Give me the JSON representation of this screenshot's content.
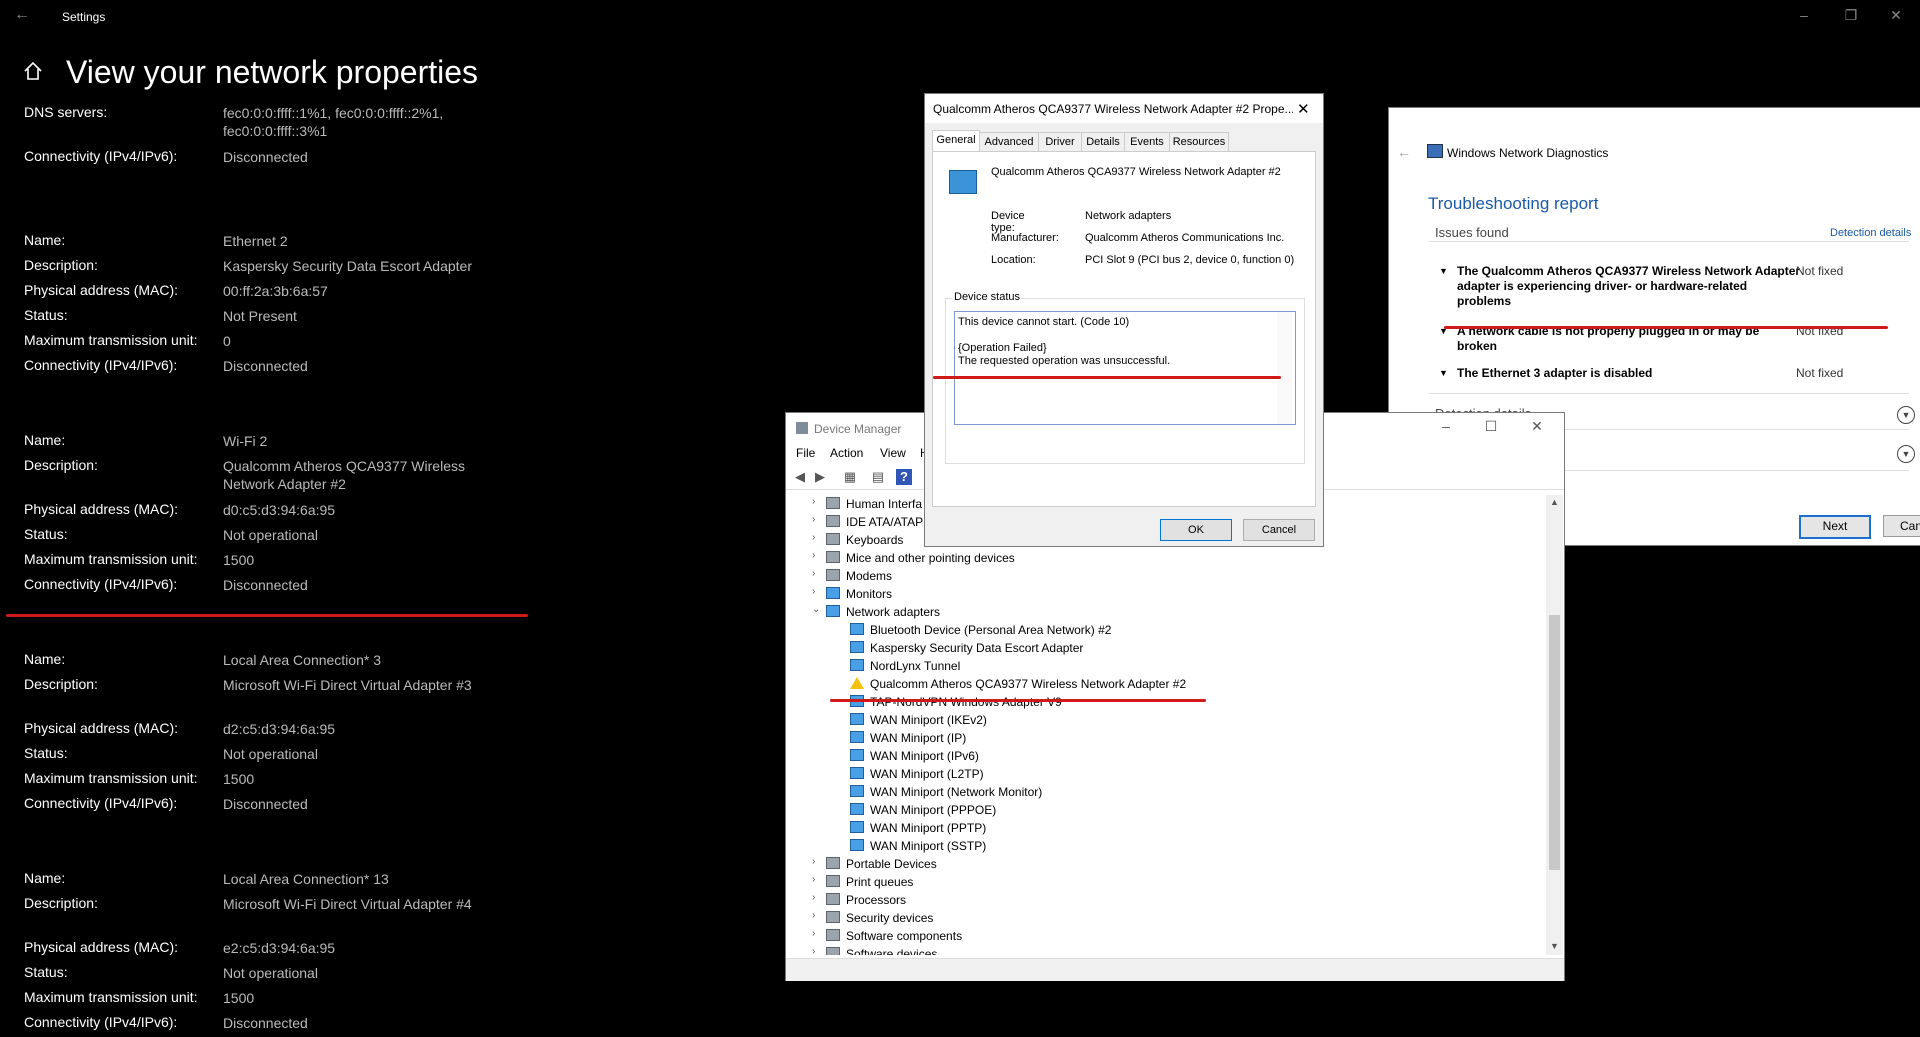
{
  "settings": {
    "window_title": "Settings",
    "page_title": "View your network properties",
    "rows": [
      {
        "label": "DNS servers:",
        "value": "fec0:0:0:ffff::1%1, fec0:0:0:ffff::2%1, fec0:0:0:ffff::3%1"
      },
      {
        "label": "Connectivity (IPv4/IPv6):",
        "value": "Disconnected"
      },
      {
        "label": "Name:",
        "value": "Ethernet 2"
      },
      {
        "label": "Description:",
        "value": "Kaspersky Security Data Escort Adapter"
      },
      {
        "label": "Physical address (MAC):",
        "value": "00:ff:2a:3b:6a:57"
      },
      {
        "label": "Status:",
        "value": "Not Present"
      },
      {
        "label": "Maximum transmission unit:",
        "value": "0"
      },
      {
        "label": "Connectivity (IPv4/IPv6):",
        "value": "Disconnected"
      },
      {
        "label": "Name:",
        "value": "Wi-Fi 2"
      },
      {
        "label": "Description:",
        "value": "Qualcomm Atheros QCA9377 Wireless Network Adapter #2"
      },
      {
        "label": "Physical address (MAC):",
        "value": "d0:c5:d3:94:6a:95"
      },
      {
        "label": "Status:",
        "value": "Not operational"
      },
      {
        "label": "Maximum transmission unit:",
        "value": "1500"
      },
      {
        "label": "Connectivity (IPv4/IPv6):",
        "value": "Disconnected"
      },
      {
        "label": "Name:",
        "value": "Local Area Connection* 3"
      },
      {
        "label": "Description:",
        "value": "Microsoft Wi-Fi Direct Virtual Adapter #3"
      },
      {
        "label": "Physical address (MAC):",
        "value": "d2:c5:d3:94:6a:95"
      },
      {
        "label": "Status:",
        "value": "Not operational"
      },
      {
        "label": "Maximum transmission unit:",
        "value": "1500"
      },
      {
        "label": "Connectivity (IPv4/IPv6):",
        "value": "Disconnected"
      },
      {
        "label": "Name:",
        "value": "Local Area Connection* 13"
      },
      {
        "label": "Description:",
        "value": "Microsoft Wi-Fi Direct Virtual Adapter #4"
      },
      {
        "label": "Physical address (MAC):",
        "value": "e2:c5:d3:94:6a:95"
      },
      {
        "label": "Status:",
        "value": "Not operational"
      },
      {
        "label": "Maximum transmission unit:",
        "value": "1500"
      },
      {
        "label": "Connectivity (IPv4/IPv6):",
        "value": "Disconnected"
      }
    ]
  },
  "diagnostics": {
    "app_title": "Windows Network Diagnostics",
    "heading": "Troubleshooting report",
    "issues_found": "Issues found",
    "detection_details_link": "Detection details",
    "issues": [
      {
        "text": "The Qualcomm Atheros QCA9377 Wireless Network Adapter adapter is experiencing driver- or hardware-related problems",
        "status": "Not fixed"
      },
      {
        "text": "A network cable is not properly plugged in or may be broken",
        "status": "Not fixed"
      },
      {
        "text": "The Ethernet 3 adapter is disabled",
        "status": "Not fixed"
      }
    ],
    "detection_details": "Detection details",
    "next_label": "Next",
    "cancel_label": "Canc"
  },
  "device_manager": {
    "title": "Device Manager",
    "menu": [
      "File",
      "Action",
      "View",
      "H"
    ],
    "tree": [
      {
        "label": "Human Interfa",
        "level": 0,
        "expanded": false,
        "icon": "generic"
      },
      {
        "label": "IDE ATA/ATAPI",
        "level": 0,
        "expanded": false,
        "icon": "generic"
      },
      {
        "label": "Keyboards",
        "level": 0,
        "expanded": false,
        "icon": "generic"
      },
      {
        "label": "Mice and other pointing devices",
        "level": 0,
        "expanded": false,
        "icon": "generic"
      },
      {
        "label": "Modems",
        "level": 0,
        "expanded": false,
        "icon": "generic"
      },
      {
        "label": "Monitors",
        "level": 0,
        "expanded": false,
        "icon": "network"
      },
      {
        "label": "Network adapters",
        "level": 0,
        "expanded": true,
        "icon": "network"
      },
      {
        "label": "Bluetooth Device (Personal Area Network) #2",
        "level": 1,
        "icon": "network"
      },
      {
        "label": "Kaspersky Security Data Escort Adapter",
        "level": 1,
        "icon": "network"
      },
      {
        "label": "NordLynx Tunnel",
        "level": 1,
        "icon": "network"
      },
      {
        "label": "Qualcomm Atheros QCA9377 Wireless Network Adapter #2",
        "level": 1,
        "icon": "warning"
      },
      {
        "label": "TAP-NordVPN Windows Adapter V9",
        "level": 1,
        "icon": "network"
      },
      {
        "label": "WAN Miniport (IKEv2)",
        "level": 1,
        "icon": "network"
      },
      {
        "label": "WAN Miniport (IP)",
        "level": 1,
        "icon": "network"
      },
      {
        "label": "WAN Miniport (IPv6)",
        "level": 1,
        "icon": "network"
      },
      {
        "label": "WAN Miniport (L2TP)",
        "level": 1,
        "icon": "network"
      },
      {
        "label": "WAN Miniport (Network Monitor)",
        "level": 1,
        "icon": "network"
      },
      {
        "label": "WAN Miniport (PPPOE)",
        "level": 1,
        "icon": "network"
      },
      {
        "label": "WAN Miniport (PPTP)",
        "level": 1,
        "icon": "network"
      },
      {
        "label": "WAN Miniport (SSTP)",
        "level": 1,
        "icon": "network"
      },
      {
        "label": "Portable Devices",
        "level": 0,
        "expanded": false,
        "icon": "generic"
      },
      {
        "label": "Print queues",
        "level": 0,
        "expanded": false,
        "icon": "generic"
      },
      {
        "label": "Processors",
        "level": 0,
        "expanded": false,
        "icon": "generic"
      },
      {
        "label": "Security devices",
        "level": 0,
        "expanded": false,
        "icon": "generic"
      },
      {
        "label": "Software components",
        "level": 0,
        "expanded": false,
        "icon": "generic"
      },
      {
        "label": "Software devices",
        "level": 0,
        "expanded": false,
        "icon": "generic"
      }
    ]
  },
  "properties": {
    "title": "Qualcomm Atheros QCA9377 Wireless Network Adapter #2 Prope...",
    "tabs": [
      "General",
      "Advanced",
      "Driver",
      "Details",
      "Events",
      "Resources"
    ],
    "active_tab": "General",
    "device_name": "Qualcomm Atheros QCA9377 Wireless Network Adapter #2",
    "device_type_label": "Device type:",
    "device_type": "Network adapters",
    "manufacturer_label": "Manufacturer:",
    "manufacturer": "Qualcomm Atheros Communications Inc.",
    "location_label": "Location:",
    "location": "PCI Slot 9 (PCI bus 2, device 0, function 0)",
    "status_group_label": "Device status",
    "status_line1": "This device cannot start. (Code 10)",
    "status_line2": "{Operation Failed}",
    "status_line3": "The requested operation was unsuccessful.",
    "ok_label": "OK",
    "cancel_label": "Cancel"
  },
  "colors": {
    "annotation_red": "#d01a1a",
    "link_blue": "#1a5aa8",
    "error_red": "#d22222"
  }
}
